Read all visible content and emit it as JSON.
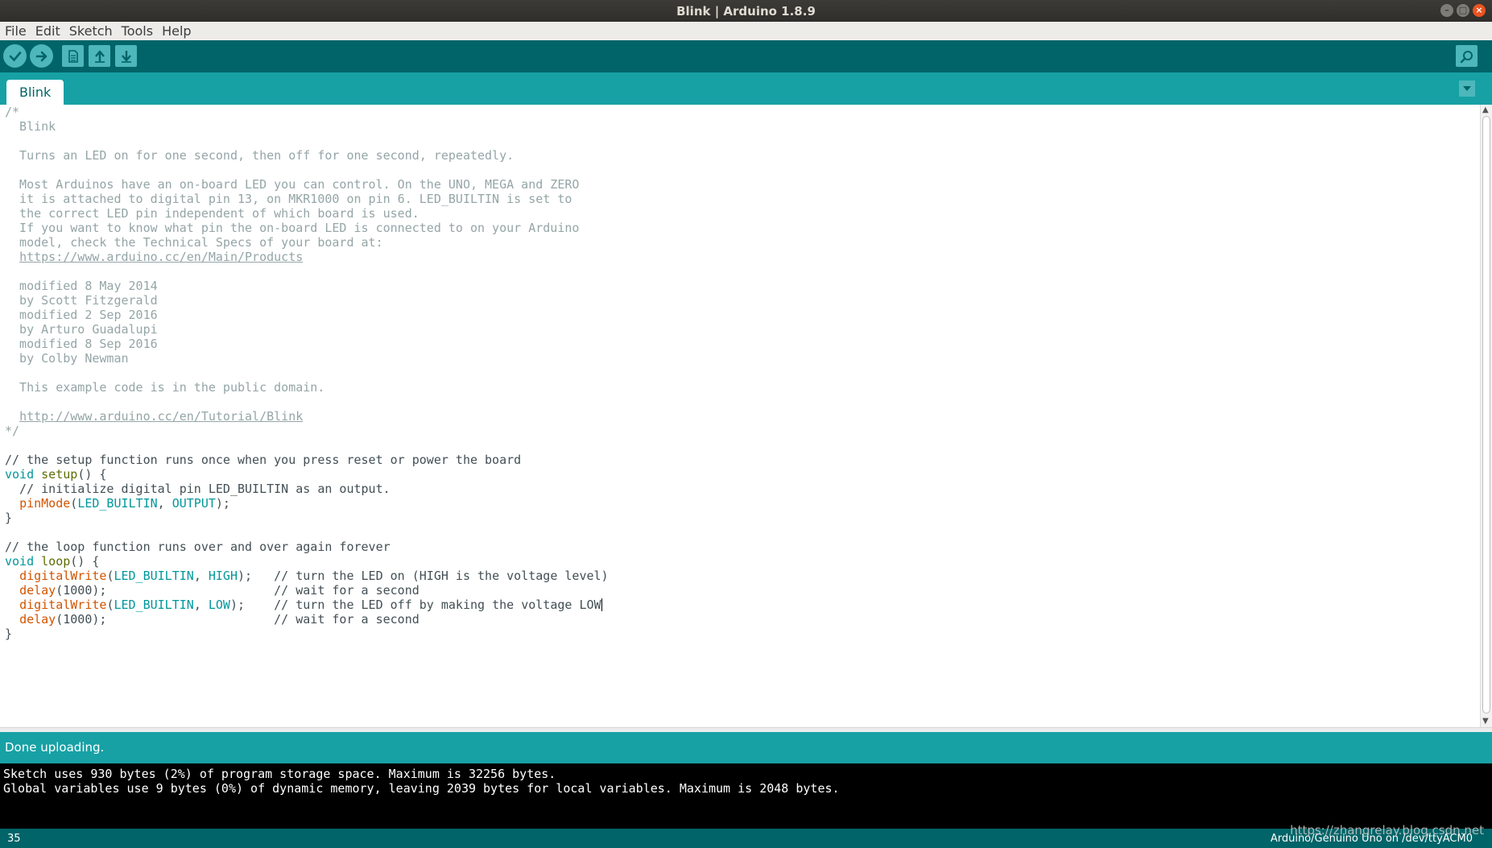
{
  "window": {
    "title": "Blink | Arduino 1.8.9"
  },
  "menu": [
    "File",
    "Edit",
    "Sketch",
    "Tools",
    "Help"
  ],
  "tab": {
    "label": "Blink"
  },
  "code_lines": [
    [
      [
        "cmt",
        "/*"
      ]
    ],
    [
      [
        "cmt",
        "  Blink"
      ]
    ],
    [],
    [
      [
        "cmt",
        "  Turns an LED on for one second, then off for one second, repeatedly."
      ]
    ],
    [],
    [
      [
        "cmt",
        "  Most Arduinos have an on-board LED you can control. On the UNO, MEGA and ZERO"
      ]
    ],
    [
      [
        "cmt",
        "  it is attached to digital pin 13, on MKR1000 on pin 6. LED_BUILTIN is set to"
      ]
    ],
    [
      [
        "cmt",
        "  the correct LED pin independent of which board is used."
      ]
    ],
    [
      [
        "cmt",
        "  If you want to know what pin the on-board LED is connected to on your Arduino"
      ]
    ],
    [
      [
        "cmt",
        "  model, check the Technical Specs of your board at:"
      ]
    ],
    [
      [
        "cmt",
        "  "
      ],
      [
        "url",
        "https://www.arduino.cc/en/Main/Products"
      ]
    ],
    [],
    [
      [
        "cmt",
        "  modified 8 May 2014"
      ]
    ],
    [
      [
        "cmt",
        "  by Scott Fitzgerald"
      ]
    ],
    [
      [
        "cmt",
        "  modified 2 Sep 2016"
      ]
    ],
    [
      [
        "cmt",
        "  by Arturo Guadalupi"
      ]
    ],
    [
      [
        "cmt",
        "  modified 8 Sep 2016"
      ]
    ],
    [
      [
        "cmt",
        "  by Colby Newman"
      ]
    ],
    [],
    [
      [
        "cmt",
        "  This example code is in the public domain."
      ]
    ],
    [],
    [
      [
        "cmt",
        "  "
      ],
      [
        "url",
        "http://www.arduino.cc/en/Tutorial/Blink"
      ]
    ],
    [
      [
        "cmt",
        "*/"
      ]
    ],
    [],
    [
      [
        "plain",
        "// the setup function runs once when you press reset or power the board"
      ]
    ],
    [
      [
        "kw",
        "void"
      ],
      [
        "plain",
        " "
      ],
      [
        "fnsel",
        "setup"
      ],
      [
        "plain",
        "() {"
      ]
    ],
    [
      [
        "plain",
        "  // initialize digital pin LED_BUILTIN as an output."
      ]
    ],
    [
      [
        "plain",
        "  "
      ],
      [
        "fn",
        "pinMode"
      ],
      [
        "plain",
        "("
      ],
      [
        "kw",
        "LED_BUILTIN"
      ],
      [
        "plain",
        ", "
      ],
      [
        "kw",
        "OUTPUT"
      ],
      [
        "plain",
        ");"
      ]
    ],
    [
      [
        "plain",
        "}"
      ]
    ],
    [],
    [
      [
        "plain",
        "// the loop function runs over and over again forever"
      ]
    ],
    [
      [
        "kw",
        "void"
      ],
      [
        "plain",
        " "
      ],
      [
        "fnsel",
        "loop"
      ],
      [
        "plain",
        "() {"
      ]
    ],
    [
      [
        "plain",
        "  "
      ],
      [
        "fn",
        "digitalWrite"
      ],
      [
        "plain",
        "("
      ],
      [
        "kw",
        "LED_BUILTIN"
      ],
      [
        "plain",
        ", "
      ],
      [
        "kw",
        "HIGH"
      ],
      [
        "plain",
        ");   // turn the LED on (HIGH is the voltage level)"
      ]
    ],
    [
      [
        "plain",
        "  "
      ],
      [
        "fn",
        "delay"
      ],
      [
        "plain",
        "(1000);                       // wait for a second"
      ]
    ],
    [
      [
        "plain",
        "  "
      ],
      [
        "fn",
        "digitalWrite"
      ],
      [
        "plain",
        "("
      ],
      [
        "kw",
        "LED_BUILTIN"
      ],
      [
        "plain",
        ", "
      ],
      [
        "kw",
        "LOW"
      ],
      [
        "plain",
        ");    // turn the LED off by making the voltage LOW"
      ],
      [
        "caret",
        ""
      ]
    ],
    [
      [
        "plain",
        "  "
      ],
      [
        "fn",
        "delay"
      ],
      [
        "plain",
        "(1000);                       // wait for a second"
      ]
    ],
    [
      [
        "plain",
        "}"
      ]
    ]
  ],
  "status": {
    "message": "Done uploading."
  },
  "console": [
    "Sketch uses 930 bytes (2%) of program storage space. Maximum is 32256 bytes.",
    "Global variables use 9 bytes (0%) of dynamic memory, leaving 2039 bytes for local variables. Maximum is 2048 bytes."
  ],
  "footer": {
    "line": "35",
    "board": "Arduino/Genuino Uno on /dev/ttyACM0"
  },
  "watermark": "https://zhangrelay.blog.csdn.net",
  "icons": {
    "verify": "checkmark-icon",
    "upload": "arrow-right-icon",
    "new": "new-file-icon",
    "open": "arrow-up-icon",
    "save": "arrow-down-icon",
    "serial_monitor": "magnifier-icon",
    "tab_menu": "chevron-down-icon"
  },
  "colors": {
    "toolbar": "#006468",
    "tabbar": "#17a1a5",
    "button": "#4db7bb",
    "comment": "#95a5a6",
    "keyword": "#00979c",
    "function": "#d35400"
  }
}
